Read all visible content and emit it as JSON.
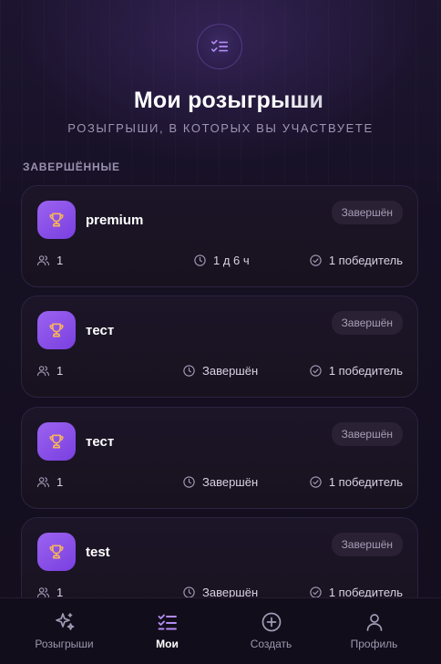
{
  "header": {
    "icon": "checklist-icon",
    "title": "Мои розыгрыши",
    "subtitle": "РОЗЫГРЫШИ, В КОТОРЫХ ВЫ УЧАСТВУЕТЕ"
  },
  "section": {
    "label": "ЗАВЕРШЁННЫЕ"
  },
  "giveaways": [
    {
      "title": "premium",
      "status": "Завершён",
      "members": "1",
      "time": "1 д 6 ч",
      "winners": "1 победитель"
    },
    {
      "title": "тест",
      "status": "Завершён",
      "members": "1",
      "time": "Завершён",
      "winners": "1 победитель"
    },
    {
      "title": "тест",
      "status": "Завершён",
      "members": "1",
      "time": "Завершён",
      "winners": "1 победитель"
    },
    {
      "title": "test",
      "status": "Завершён",
      "members": "1",
      "time": "Завершён",
      "winners": "1 победитель"
    }
  ],
  "nav": {
    "items": [
      {
        "label": "Розыгрыши",
        "icon": "sparkles-icon",
        "active": false
      },
      {
        "label": "Мои",
        "icon": "checklist-icon",
        "active": true
      },
      {
        "label": "Создать",
        "icon": "plus-circle-icon",
        "active": false
      },
      {
        "label": "Профиль",
        "icon": "user-icon",
        "active": false
      }
    ]
  },
  "colors": {
    "background": "#140f1f",
    "accent": "#8b52ea",
    "trophy": "#f5b45a",
    "card_border": "#2c2340",
    "status_bg": "#2a2134"
  }
}
